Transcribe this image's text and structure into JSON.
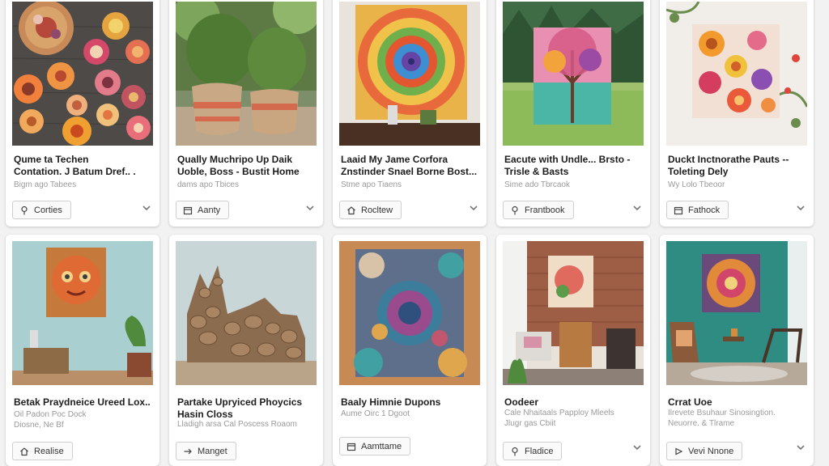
{
  "cards": [
    {
      "title": "Qume ta Techen\nContation. J Batum Dref.. .",
      "meta": "Bigm ago Tabees",
      "button": "Corties",
      "icon": "pin-icon"
    },
    {
      "title": "Qually Muchripo Up Daik\nUoble, Boss - Bustit Home",
      "meta": "dams apo Tbices",
      "button": "Aanty",
      "icon": "calendar-icon"
    },
    {
      "title": "Laaid My Jame Corfora\nZnstinder Snael Borne Bost...",
      "meta": "Stme apo Tiaens",
      "button": "Rocltew",
      "icon": "home-icon"
    },
    {
      "title": "Eacute with Undle... Brsto -\nTrisle & Basts",
      "meta": "Sime ado Tbrcaok",
      "button": "Frantbook",
      "icon": "pin-icon"
    },
    {
      "title": "Duckt Inctnorathe Pauts --\nToleting Dely",
      "meta": "Wy Lolo Tbeoor",
      "button": "Fathock",
      "icon": "calendar-icon"
    },
    {
      "title": "Betak Praydneice Ureed Lox..",
      "meta": "Oil Padon Poc Dock\nDiosne, Ne Bf",
      "button": "Realise",
      "icon": "home-icon"
    },
    {
      "title": "Partake Upryiced Phoycics\nHasin Closs",
      "meta": "Lladigh arsa Cal Poscess Roaom",
      "button": "Manget",
      "icon": "arrow-icon"
    },
    {
      "title": "Baaly Himnie Dupons",
      "meta": "Aume Oirc 1 Dgoot",
      "button": "Aamttame",
      "icon": "calendar-icon"
    },
    {
      "title": "Oodeer",
      "meta": "Cale Nhaitaals Papploy Mleels\nJlugr gas Cbiit",
      "button": "Fladice",
      "icon": "pin-icon"
    },
    {
      "title": "Crrat Uoe",
      "meta": "Ilrevete Bsuhaur Sinosingtion.\nNeuorre. & Tlrame",
      "button": "Vevi Nnone",
      "icon": "video-icon"
    }
  ]
}
